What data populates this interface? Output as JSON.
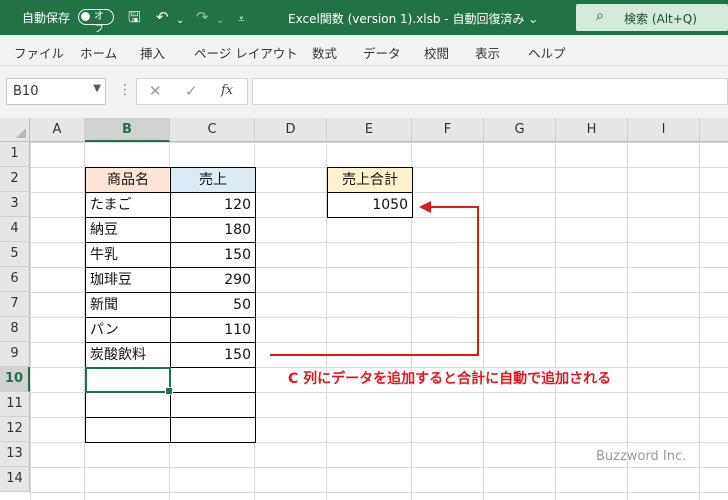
{
  "titlebar": {
    "autosave_label": "自動保存",
    "autosave_state": "オフ",
    "doc_title": "Excel関数 (version 1).xlsb  -  自動回復済み  ⌄",
    "search_label": "検索 (Alt+Q)",
    "icons": [
      "save-icon",
      "undo-icon",
      "redo-icon",
      "customize-icon"
    ]
  },
  "ribbon": {
    "tabs": [
      "ファイル",
      "ホーム",
      "挿入",
      "ページ レイアウト",
      "数式",
      "データ",
      "校閲",
      "表示",
      "ヘルプ"
    ]
  },
  "formula_bar": {
    "name_box": "B10",
    "fx": "fx",
    "content": ""
  },
  "sheet": {
    "columns": [
      "A",
      "B",
      "C",
      "D",
      "E",
      "F",
      "G",
      "H",
      "I"
    ],
    "rows": [
      "1",
      "2",
      "3",
      "4",
      "5",
      "6",
      "7",
      "8",
      "9",
      "10",
      "11",
      "12",
      "13",
      "14"
    ],
    "selected_column": "B",
    "selected_row": "10",
    "table": {
      "header_name": "商品名",
      "header_sales": "売上",
      "rows": [
        {
          "name": "たまご",
          "sales": "120"
        },
        {
          "name": "納豆",
          "sales": "180"
        },
        {
          "name": "牛乳",
          "sales": "150"
        },
        {
          "name": "珈琲豆",
          "sales": "290"
        },
        {
          "name": "新聞",
          "sales": "50"
        },
        {
          "name": "パン",
          "sales": "110"
        },
        {
          "name": "炭酸飲料",
          "sales": "150"
        }
      ]
    },
    "total": {
      "header": "売上合計",
      "value": "1050"
    }
  },
  "annotation": {
    "text": "C 列にデータを追加すると合計に自動で追加される",
    "color": "#e0191e"
  },
  "watermark": "Buzzword Inc.",
  "colors": {
    "excel_green": "#217346",
    "header_orange": "#fce4d6",
    "header_blue": "#ddebf7",
    "header_yellow": "#fff2cc"
  }
}
